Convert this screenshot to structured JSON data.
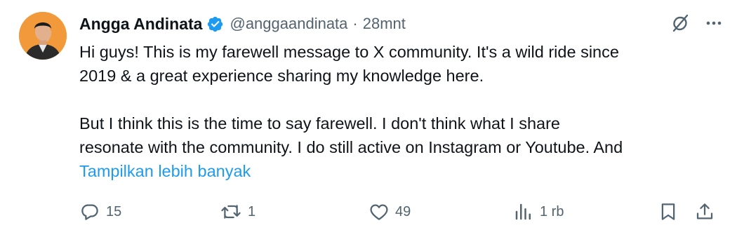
{
  "tweet": {
    "author": {
      "display_name": "Angga Andinata",
      "handle": "@anggaandinata",
      "separator": "·",
      "time": "28mnt",
      "verified": true
    },
    "body": {
      "line1": "Hi guys! This is my farewell message to X community. It's a wild ride since",
      "line2": "2019 & a great experience sharing my knowledge here.",
      "line3": "But I think this is the time to say farewell.  I don't think what I share",
      "line4": "resonate with the community. I do still active on Instagram or Youtube. And",
      "show_more": "Tampilkan lebih banyak"
    },
    "metrics": {
      "replies": "15",
      "reposts": "1",
      "likes": "49",
      "views": "1 rb"
    }
  },
  "icons": {
    "grok": "grok-icon",
    "more": "more-icon",
    "reply": "reply-icon",
    "repost": "repost-icon",
    "like": "like-icon",
    "views": "views-icon",
    "bookmark": "bookmark-icon",
    "share": "share-icon"
  },
  "colors": {
    "text_primary": "#0f1419",
    "text_secondary": "#536471",
    "accent": "#1d9bf0",
    "avatar_bg": "#f29a3b"
  }
}
